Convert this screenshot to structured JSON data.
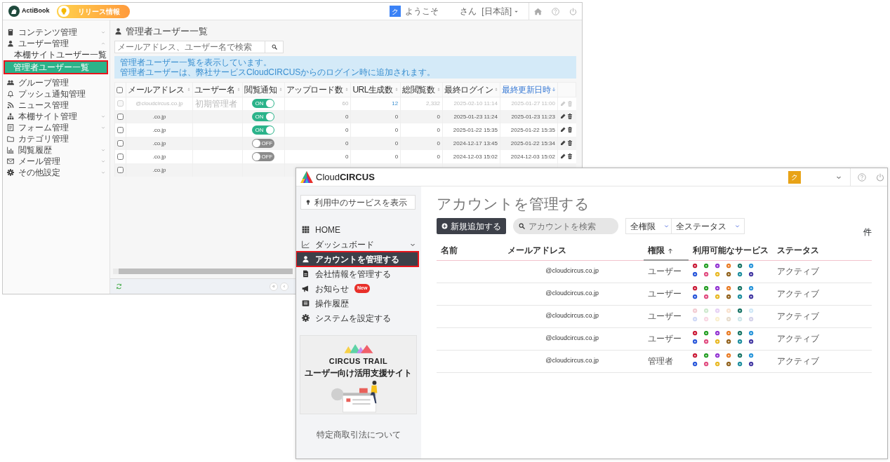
{
  "back_window": {
    "header": {
      "logo": "ActiBook",
      "release_button": "リリース情報",
      "user_initial": "ク",
      "welcome": "ようこそ",
      "user_suffix": "さん",
      "language": "[日本語]"
    },
    "sidebar": [
      {
        "label": "コンテンツ管理",
        "expanded": false,
        "selected": false
      },
      {
        "label": "ユーザー管理",
        "expanded": true,
        "selected": false,
        "children": [
          {
            "label": "本棚サイトユーザー一覧",
            "selected": false
          },
          {
            "label": "管理者ユーザー一覧",
            "selected": true
          }
        ]
      },
      {
        "label": "グループ管理",
        "selected": false
      },
      {
        "label": "プッシュ通知管理",
        "selected": false
      },
      {
        "label": "ニュース管理",
        "selected": false
      },
      {
        "label": "本棚サイト管理",
        "expanded": false,
        "selected": false
      },
      {
        "label": "フォーム管理",
        "expanded": false,
        "selected": false
      },
      {
        "label": "カテゴリ管理",
        "selected": false
      },
      {
        "label": "閲覧履歴",
        "expanded": false,
        "selected": false
      },
      {
        "label": "メール管理",
        "expanded": false,
        "selected": false
      },
      {
        "label": "その他設定",
        "expanded": false,
        "selected": false
      }
    ],
    "title": "管理者ユーザー一覧",
    "search": {
      "placeholder": "メールアドレス、ユーザー名で検索"
    },
    "info": [
      "管理者ユーザー一覧を表示しています。",
      "管理者ユーザーは、弊社サービスCloudCIRCUSからのログイン時に追加されます。"
    ],
    "table": {
      "select_all_checked": false,
      "columns": [
        {
          "label": "メールアドレス",
          "sorted": false
        },
        {
          "label": "ユーザー名",
          "sorted": false
        },
        {
          "label": "閲覧通知",
          "sorted": false
        },
        {
          "label": "アップロード数",
          "sorted": false
        },
        {
          "label": "URL生成数",
          "sorted": false
        },
        {
          "label": "総閲覧数",
          "sorted": false
        },
        {
          "label": "最終ログイン",
          "sorted": false
        },
        {
          "label": "最終更新日時",
          "sorted": true
        }
      ],
      "rows": [
        {
          "checked": false,
          "disabled": true,
          "email": "@cloudcircus.co.jp",
          "user": "初期管理者",
          "notify": {
            "on": true,
            "label": "ON"
          },
          "uploads": "60",
          "urls": "12",
          "url_link": true,
          "views": "2,332",
          "last_login": "2025-02-10 11:14",
          "updated": "2025-01-27 11:00"
        },
        {
          "checked": false,
          "disabled": false,
          "email": ".co.jp",
          "notify": {
            "on": true,
            "label": "ON"
          },
          "uploads": "0",
          "urls": "0",
          "url_link": false,
          "views": "0",
          "last_login": "2025-01-23 11:24",
          "updated": "2025-01-23 11:23"
        },
        {
          "checked": false,
          "disabled": false,
          "email": ".co.jp",
          "notify": {
            "on": true,
            "label": "ON"
          },
          "uploads": "0",
          "urls": "0",
          "url_link": false,
          "views": "0",
          "last_login": "2025-01-22 15:35",
          "updated": "2025-01-22 15:35"
        },
        {
          "checked": false,
          "disabled": false,
          "email": ".co.jp",
          "notify": {
            "on": false,
            "label": "OFF"
          },
          "uploads": "0",
          "urls": "0",
          "url_link": false,
          "views": "0",
          "last_login": "2024-12-17 13:45",
          "updated": "2025-01-22 15:34"
        },
        {
          "checked": false,
          "disabled": false,
          "email": ".co.jp",
          "notify": {
            "on": false,
            "label": "OFF"
          },
          "uploads": "0",
          "urls": "0",
          "url_link": false,
          "views": "0",
          "last_login": "2024-12-03 15:02",
          "updated": "2024-12-03 15:02"
        },
        {
          "checked": false,
          "disabled": false,
          "email": ".co.jp"
        }
      ]
    },
    "pager": [
      "«",
      "‹"
    ]
  },
  "account_window": {
    "header": {
      "logo": "Cloud**CIRCUS**",
      "user_initial": "ク"
    },
    "sidebar": {
      "services_button": "利用中のサービスを表示",
      "items": [
        {
          "label": "HOME",
          "selected": false
        },
        {
          "label": "ダッシュボード",
          "expanded": false,
          "selected": false
        },
        {
          "label": "アカウントを管理する",
          "selected": true
        },
        {
          "label": "会社情報を管理する",
          "selected": false
        },
        {
          "label": "お知らせ",
          "selected": false,
          "badge": "New"
        },
        {
          "label": "操作履歴",
          "selected": false
        },
        {
          "label": "システムを設定する",
          "selected": false
        }
      ],
      "banner": {
        "title": "CIRCUS TRAIL",
        "subtitle": "ユーザー向け活用支援サイト"
      },
      "footer_link": "特定商取引法について"
    },
    "title": "アカウントを管理する",
    "add_button": "新規追加する",
    "search": {
      "placeholder": "アカウントを検索"
    },
    "filters": [
      "全権限",
      "全ステータス"
    ],
    "count_unit": "件",
    "service_colors": [
      {
        "color": "#c8102e"
      },
      {
        "color": "#1a9a1a"
      },
      {
        "color": "#8e2bd0"
      },
      {
        "color": "#e8751a"
      },
      {
        "color": "#0d6e5f"
      },
      {
        "color": "#1e90d8"
      },
      {
        "color": "#1f4fd8"
      },
      {
        "color": "#e0457b"
      },
      {
        "color": "#e8b61a"
      },
      {
        "color": "#8c5a12"
      },
      {
        "color": "#12899a"
      },
      {
        "color": "#3b2f9e"
      }
    ],
    "table": {
      "columns": [
        {
          "label": "名前",
          "sorted": false
        },
        {
          "label": "メールアドレス",
          "sorted": false
        },
        {
          "label": "権限",
          "sorted": true
        },
        {
          "label": "利用可能なサービス",
          "sorted": false
        },
        {
          "label": "ステータス",
          "sorted": false
        }
      ],
      "rows": [
        {
          "email": "@cloudcircus.co.jp",
          "role": "ユーザー",
          "services": [
            true,
            true,
            true,
            true,
            true,
            true,
            true,
            true,
            true,
            true,
            true,
            true
          ],
          "status": "アクティブ"
        },
        {
          "email": "@cloudcircus.co.jp",
          "role": "ユーザー",
          "services": [
            true,
            true,
            true,
            true,
            true,
            true,
            true,
            true,
            true,
            true,
            true,
            true
          ],
          "status": "アクティブ"
        },
        {
          "email": "@cloudcircus.co.jp",
          "role": "ユーザー",
          "services": [
            false,
            false,
            false,
            false,
            true,
            false,
            false,
            false,
            false,
            false,
            false,
            false
          ],
          "status": "アクティブ"
        },
        {
          "email": "@cloudcircus.co.jp",
          "role": "ユーザー",
          "services": [
            true,
            true,
            true,
            true,
            true,
            true,
            true,
            true,
            true,
            true,
            true,
            true
          ],
          "status": "アクティブ"
        },
        {
          "email": "@cloudcircus.co.jp",
          "role": "管理者",
          "services": [
            true,
            true,
            true,
            true,
            true,
            true,
            true,
            true,
            true,
            true,
            true,
            true
          ],
          "status": "アクティブ"
        }
      ]
    }
  }
}
